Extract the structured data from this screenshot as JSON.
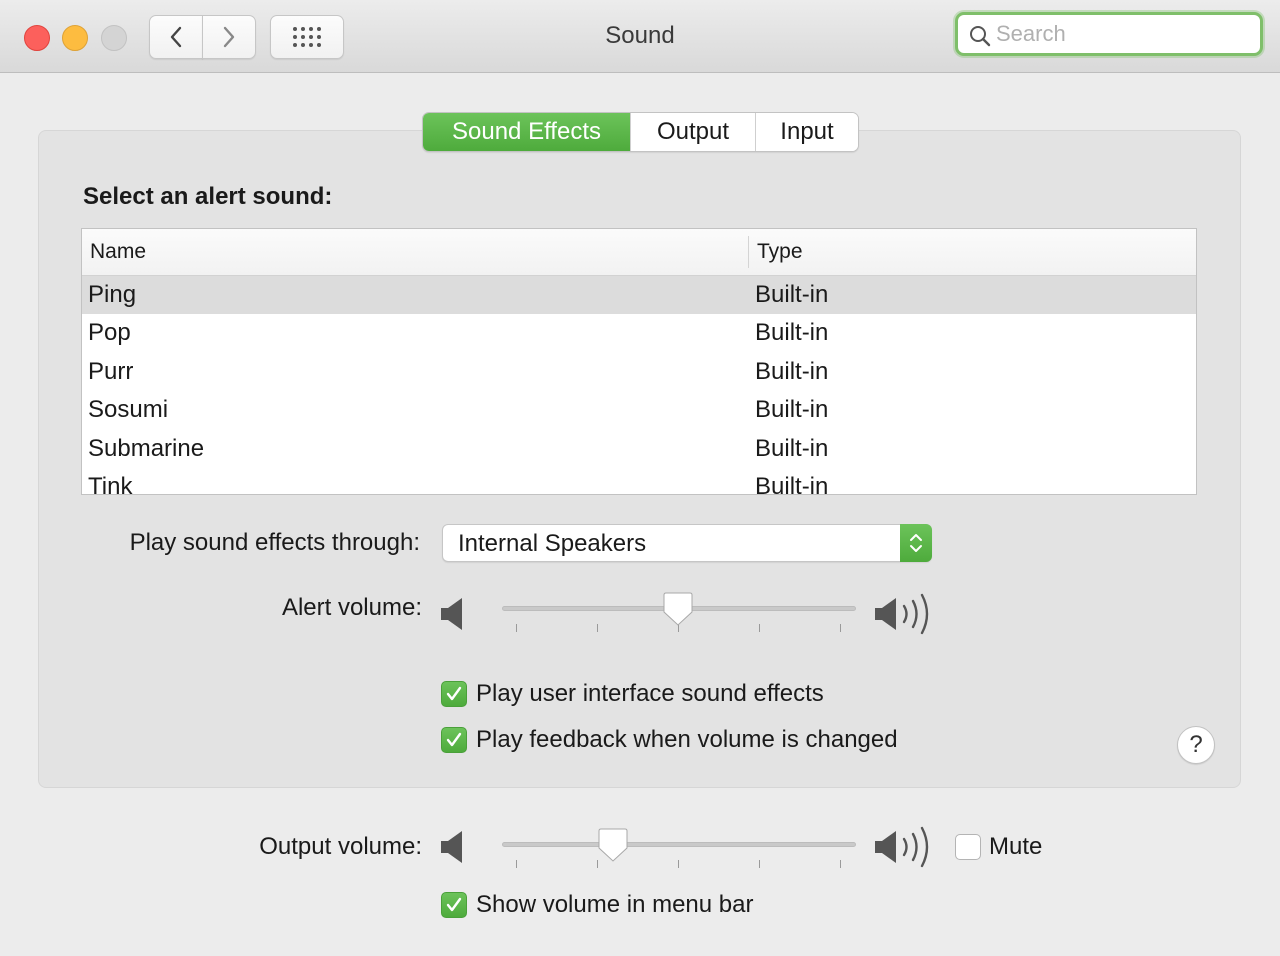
{
  "window": {
    "title": "Sound",
    "search_placeholder": "Search"
  },
  "tabs": [
    {
      "label": "Sound Effects",
      "active": true
    },
    {
      "label": "Output",
      "active": false
    },
    {
      "label": "Input",
      "active": false
    }
  ],
  "alert_section": {
    "label": "Select an alert sound:",
    "columns": [
      "Name",
      "Type"
    ],
    "rows": [
      {
        "name": "Ping",
        "type": "Built-in",
        "selected": true
      },
      {
        "name": "Pop",
        "type": "Built-in",
        "selected": false
      },
      {
        "name": "Purr",
        "type": "Built-in",
        "selected": false
      },
      {
        "name": "Sosumi",
        "type": "Built-in",
        "selected": false
      },
      {
        "name": "Submarine",
        "type": "Built-in",
        "selected": false
      },
      {
        "name": "Tink",
        "type": "Built-in",
        "selected": false
      }
    ]
  },
  "play_through": {
    "label": "Play sound effects through:",
    "selected": "Internal Speakers"
  },
  "alert_volume": {
    "label": "Alert volume:",
    "level": 0.5
  },
  "options": {
    "ui_sounds": {
      "label": "Play user interface sound effects",
      "checked": true
    },
    "feedback": {
      "label": "Play feedback when volume is changed",
      "checked": true
    }
  },
  "help_label": "?",
  "output_volume": {
    "label": "Output volume:",
    "level": 0.3,
    "mute_label": "Mute",
    "muted": false
  },
  "menu_bar": {
    "label": "Show volume in menu bar",
    "checked": true
  },
  "colors": {
    "accent": "#4eab3c",
    "close": "#fc605c",
    "minimize": "#fdbc40"
  }
}
